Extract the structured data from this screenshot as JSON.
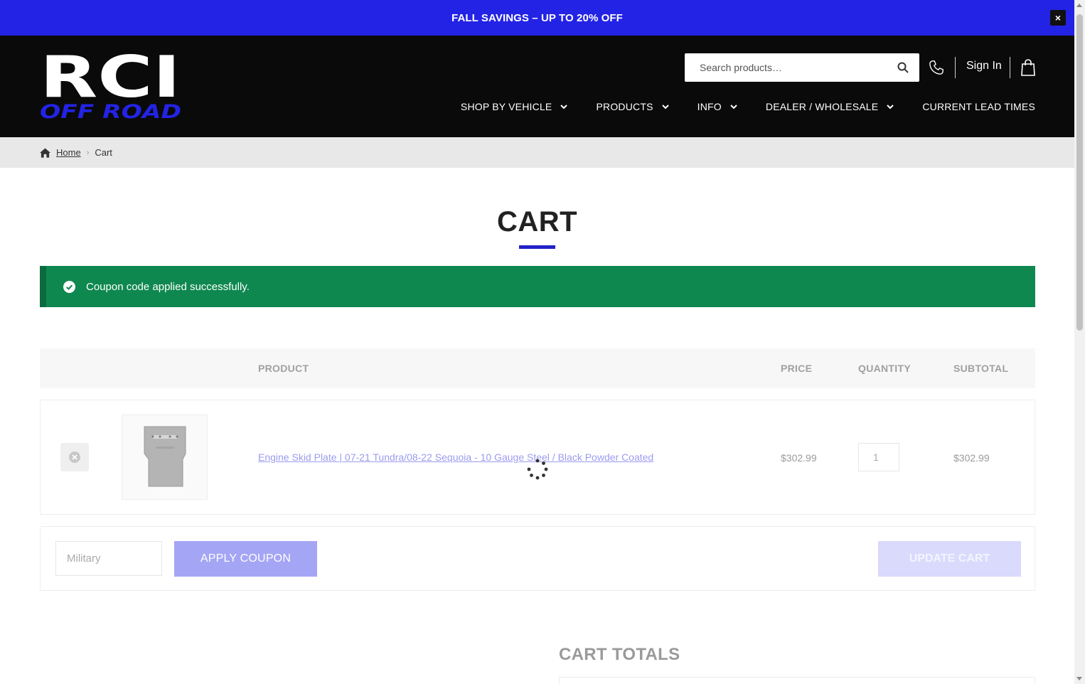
{
  "promo": {
    "text": "FALL SAVINGS – UP TO 20% OFF",
    "close": "×"
  },
  "brand": {
    "logo_text_top": "RCI",
    "logo_text_bottom": "OFF ROAD",
    "accent_color": "#2323e6"
  },
  "header": {
    "search_placeholder": "Search products…",
    "sign_in": "Sign In",
    "nav": [
      {
        "label": "SHOP BY VEHICLE"
      },
      {
        "label": "PRODUCTS"
      },
      {
        "label": "INFO"
      },
      {
        "label": "DEALER / WHOLESALE"
      },
      {
        "label": "CURRENT LEAD TIMES"
      }
    ]
  },
  "breadcrumb": {
    "home": "Home",
    "current": "Cart"
  },
  "page": {
    "title": "CART"
  },
  "notice": {
    "text": "Coupon code applied successfully.",
    "color": "#0f8850"
  },
  "table": {
    "headers": {
      "product": "PRODUCT",
      "price": "PRICE",
      "quantity": "QUANTITY",
      "subtotal": "SUBTOTAL"
    },
    "rows": [
      {
        "product": "Engine Skid Plate | 07-21 Tundra/08-22 Sequoia - 10 Gauge Steel / Black Powder Coated",
        "price": "$302.99",
        "quantity": "1",
        "subtotal": "$302.99"
      }
    ]
  },
  "actions": {
    "coupon_value": "Military",
    "apply": "APPLY COUPON",
    "update": "UPDATE CART"
  },
  "totals": {
    "title": "CART TOTALS"
  }
}
